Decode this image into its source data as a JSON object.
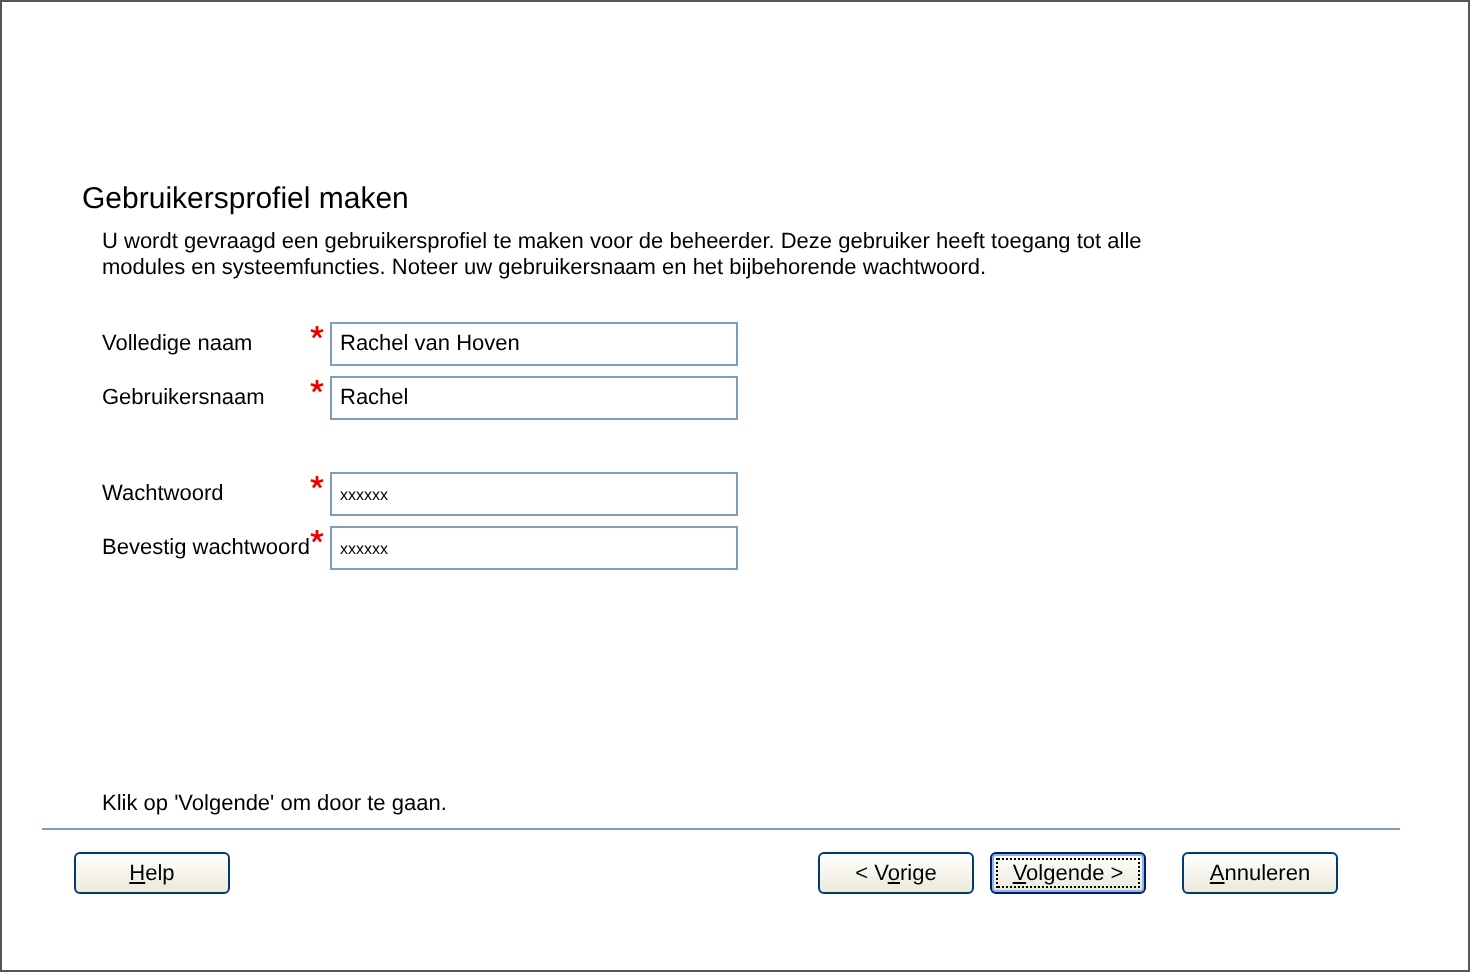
{
  "page": {
    "title": "Gebruikersprofiel maken",
    "description": "U wordt gevraagd een gebruikersprofiel te maken voor de beheerder. Deze gebruiker heeft toegang tot alle modules en systeemfuncties. Noteer uw gebruikersnaam en het bijbehorende wachtwoord."
  },
  "field_groups": [
    [
      {
        "label": "Volledige naam",
        "required": true,
        "value": "Rachel van Hoven"
      },
      {
        "label": "Gebruikersnaam",
        "required": true,
        "value": "Rachel"
      }
    ],
    [
      {
        "label": "Wachtwoord",
        "required": true,
        "value": "xxxxxx",
        "kind": "password"
      },
      {
        "label": "Bevestig wachtwoord",
        "required": true,
        "value": "xxxxxx",
        "kind": "password"
      }
    ]
  ],
  "hint": "Klik op 'Volgende' om door te gaan.",
  "buttons": [
    {
      "access_key": "H",
      "label_after": "elp",
      "default": false
    },
    {
      "label_before": "< V",
      "access_key": "o",
      "label_after": "rige",
      "default": false
    },
    {
      "access_key": "V",
      "label_after": "olgende >",
      "default": true
    },
    {
      "access_key": "A",
      "label_after": "nnuleren",
      "default": false
    }
  ]
}
